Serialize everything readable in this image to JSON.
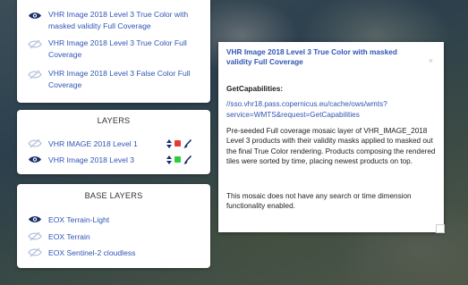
{
  "overlays": {
    "items": [
      {
        "label": "VHR Image 2018 Level 3 True Color with masked validity Full Coverage",
        "visible": true,
        "icon": "eye-icon"
      },
      {
        "label": "VHR Image 2018 Level 3 True Color Full Coverage",
        "visible": false,
        "icon": "eye-slash-icon"
      },
      {
        "label": "VHR Image 2018 Level 3 False Color Full Coverage",
        "visible": false,
        "icon": "eye-slash-icon"
      }
    ]
  },
  "layers": {
    "title": "LAYERS",
    "items": [
      {
        "label": "VHR IMAGE 2018 Level 1",
        "visible": false,
        "color": "#e53935"
      },
      {
        "label": "VHR Image 2018 Level 3",
        "visible": true,
        "color": "#2ecc40"
      }
    ]
  },
  "base_layers": {
    "title": "BASE LAYERS",
    "items": [
      {
        "label": "EOX Terrain-Light",
        "visible": true
      },
      {
        "label": "EOX Terrain",
        "visible": false
      },
      {
        "label": "EOX Sentinel-2 cloudless",
        "visible": false
      }
    ]
  },
  "popup": {
    "title": "VHR Image 2018 Level 3 True Color with masked validity Full Coverage",
    "close": "×",
    "subtitle": "GetCapabilities:",
    "link": "//sso.vhr18.pass.copernicus.eu/cache/ows/wmts?service=WMTS&request=GetCapabilities",
    "description": "Pre-seeded Full coverage mosaic layer of VHR_IMAGE_2018 Level 3 products with their validity masks applied to masked out the final True Color rendering. Products composing the rendered tiles were sorted by time, placing newest products on top.",
    "note": "This mosaic does not have any search or time dimension functionality enabled."
  },
  "colors": {
    "accent": "#2f56b5",
    "eye_active": "#1a2f6b",
    "eye_inactive": "#b8c2dc"
  }
}
